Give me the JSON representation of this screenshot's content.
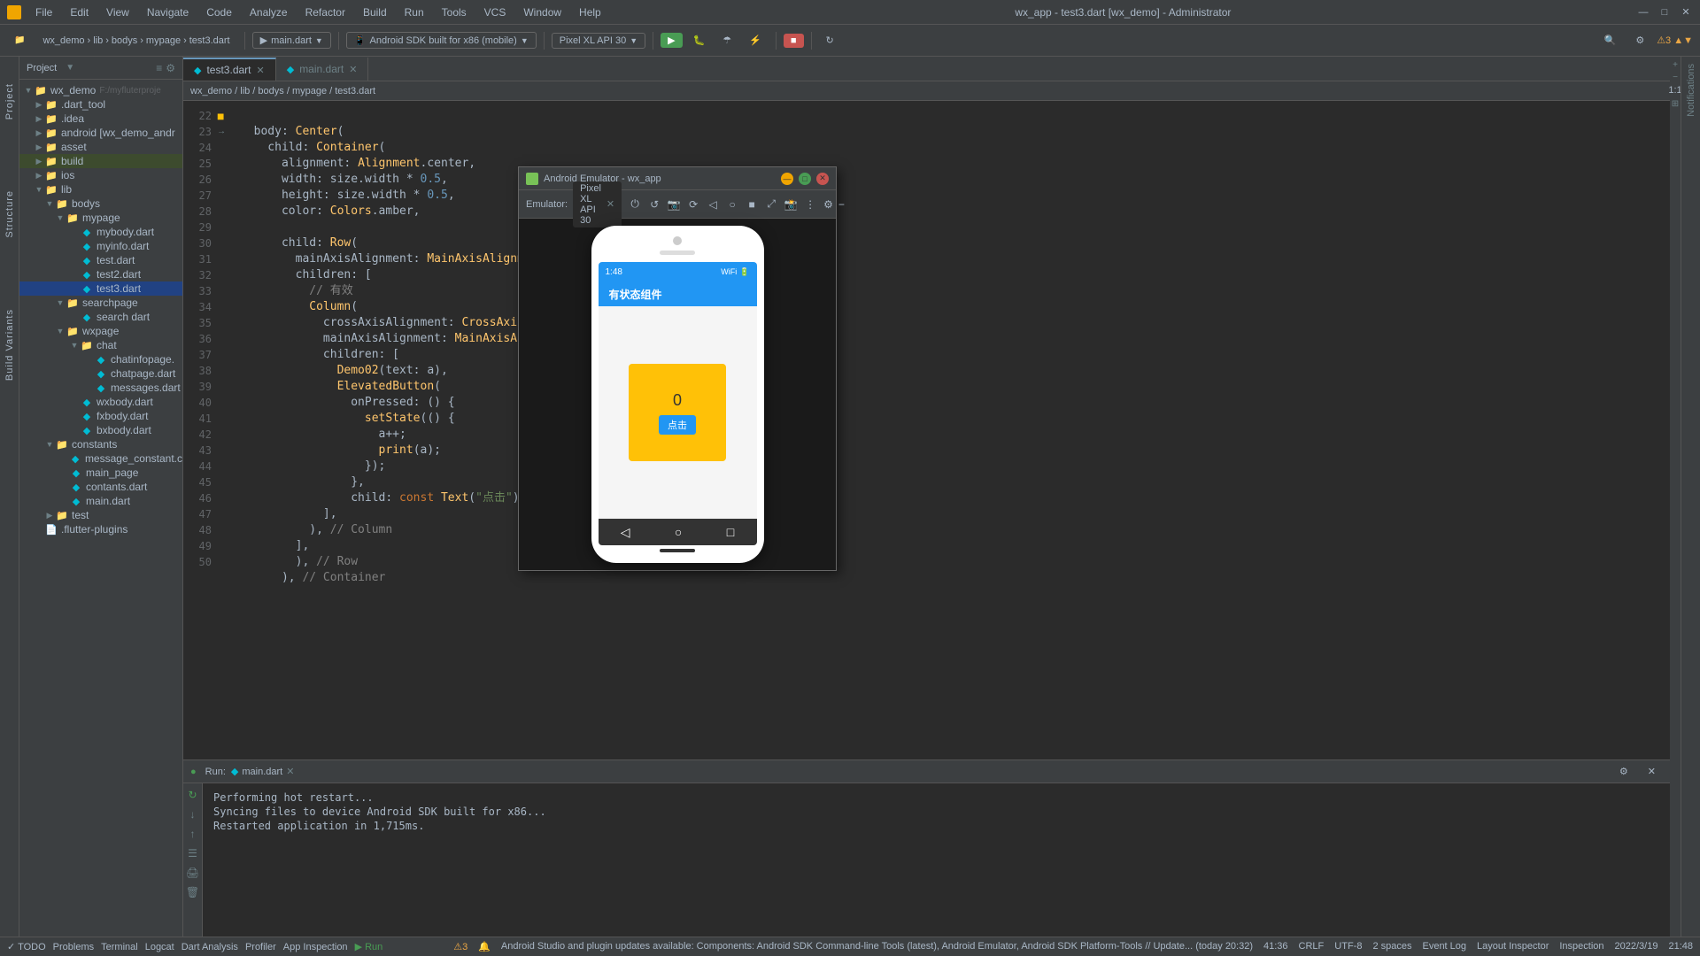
{
  "window": {
    "title": "wx_app - test3.dart [wx_demo] - Administrator",
    "min": "—",
    "max": "□",
    "close": "✕"
  },
  "menu": {
    "items": [
      "File",
      "Edit",
      "View",
      "Navigate",
      "Code",
      "Analyze",
      "Refactor",
      "Build",
      "Run",
      "Tools",
      "VCS",
      "Window",
      "Help"
    ]
  },
  "toolbar": {
    "project_label": "wx_demo",
    "lib_label": "lib",
    "bodys_label": "bodys",
    "mypage_label": "mypage",
    "file_label": "test3.dart",
    "run_config": "main.dart",
    "device": "Android SDK built for x86 (mobile)",
    "api": "Pixel XL API 30",
    "run_btn": "▶",
    "debug_btn": "🐛",
    "stop_btn": "■"
  },
  "breadcrumb": {
    "path": "wx_demo / lib / bodys / mypage / test3.dart"
  },
  "tabs": {
    "test3": "test3.dart",
    "main": "main.dart"
  },
  "project_panel": {
    "title": "Project",
    "root": "wx_demo",
    "root_path": "F:/myfluterproje",
    "items": [
      {
        "indent": 1,
        "label": ".dart_tool",
        "type": "folder",
        "open": true
      },
      {
        "indent": 1,
        "label": ".idea",
        "type": "folder"
      },
      {
        "indent": 1,
        "label": "android [wx_demo_andr",
        "type": "folder"
      },
      {
        "indent": 1,
        "label": "asset",
        "type": "folder"
      },
      {
        "indent": 1,
        "label": "build",
        "type": "folder",
        "highlight": true
      },
      {
        "indent": 1,
        "label": "ios",
        "type": "folder"
      },
      {
        "indent": 1,
        "label": "lib",
        "type": "folder",
        "open": true
      },
      {
        "indent": 2,
        "label": "bodys",
        "type": "folder",
        "open": true
      },
      {
        "indent": 3,
        "label": "mypage",
        "type": "folder",
        "open": true
      },
      {
        "indent": 4,
        "label": "mybody.dart",
        "type": "dart"
      },
      {
        "indent": 4,
        "label": "myinfo.dart",
        "type": "dart"
      },
      {
        "indent": 4,
        "label": "test.dart",
        "type": "dart"
      },
      {
        "indent": 4,
        "label": "test2.dart",
        "type": "dart"
      },
      {
        "indent": 4,
        "label": "test3.dart",
        "type": "dart",
        "selected": true
      },
      {
        "indent": 3,
        "label": "searchpage",
        "type": "folder",
        "open": true
      },
      {
        "indent": 4,
        "label": "search.dart",
        "type": "dart"
      },
      {
        "indent": 3,
        "label": "wxpage",
        "type": "folder",
        "open": true
      },
      {
        "indent": 4,
        "label": "chat",
        "type": "folder",
        "open": true
      },
      {
        "indent": 5,
        "label": "chatinfopage.",
        "type": "dart"
      },
      {
        "indent": 5,
        "label": "chatpage.dart",
        "type": "dart"
      },
      {
        "indent": 5,
        "label": "messages.dart",
        "type": "dart"
      },
      {
        "indent": 4,
        "label": "wxbody.dart",
        "type": "dart"
      },
      {
        "indent": 4,
        "label": "fxbody.dart",
        "type": "dart"
      },
      {
        "indent": 4,
        "label": "bxbody.dart",
        "type": "dart"
      },
      {
        "indent": 2,
        "label": "constants",
        "type": "folder",
        "open": true
      },
      {
        "indent": 3,
        "label": "message_constant.c",
        "type": "dart"
      },
      {
        "indent": 3,
        "label": "main_page",
        "type": "dart"
      },
      {
        "indent": 3,
        "label": "contants.dart",
        "type": "dart"
      },
      {
        "indent": 3,
        "label": "main.dart",
        "type": "dart"
      },
      {
        "indent": 2,
        "label": "test",
        "type": "folder"
      },
      {
        "indent": 1,
        "label": ".flutter-plugins",
        "type": "file"
      }
    ]
  },
  "code": {
    "lines": [
      {
        "num": 22,
        "content": "  body: Center("
      },
      {
        "num": 23,
        "content": "    child: Container("
      },
      {
        "num": 24,
        "content": "      alignment: Alignment.center,"
      },
      {
        "num": 25,
        "content": "      width: size.width * 0.5,"
      },
      {
        "num": 26,
        "content": "      height: size.width * 0.5,"
      },
      {
        "num": 27,
        "content": "      color: Colors.amber,",
        "has_indicator": true
      },
      {
        "num": 28,
        "content": ""
      },
      {
        "num": 29,
        "content": "      child: Row("
      },
      {
        "num": 30,
        "content": "        mainAxisAlignment: MainAxisAlignment.center,"
      },
      {
        "num": 31,
        "content": "        children: ["
      },
      {
        "num": 32,
        "content": "          // 有效"
      },
      {
        "num": 33,
        "content": "          Column("
      },
      {
        "num": 34,
        "content": "            crossAxisAlignment: CrossAxisAlignment.cen"
      },
      {
        "num": 35,
        "content": "            mainAxisAlignment: MainAxisAlignment.cente"
      },
      {
        "num": 36,
        "content": "            children: ["
      },
      {
        "num": 37,
        "content": "              Demo02(text: a),"
      },
      {
        "num": 38,
        "content": "              ElevatedButton("
      },
      {
        "num": 39,
        "content": "                onPressed: () {"
      },
      {
        "num": 40,
        "content": "                  setState(() {"
      },
      {
        "num": 41,
        "content": "                    a++;",
        "has_arrow": true
      },
      {
        "num": 42,
        "content": "                    print(a);"
      },
      {
        "num": 43,
        "content": "                  });"
      },
      {
        "num": 44,
        "content": "                },"
      },
      {
        "num": 45,
        "content": "                child: const Text(\"点击\")), // Eleva"
      },
      {
        "num": 46,
        "content": "            ],"
      },
      {
        "num": 47,
        "content": "          ), // Column"
      },
      {
        "num": 48,
        "content": "        ],"
      },
      {
        "num": 49,
        "content": "        ), // Row"
      },
      {
        "num": 50,
        "content": "      ), // Container"
      }
    ]
  },
  "run_panel": {
    "tab": "main.dart",
    "close": "✕",
    "lines": [
      "Performing hot restart...",
      "Syncing files to device Android SDK built for x86...",
      "Restarted application in 1,715ms."
    ]
  },
  "emulator": {
    "title": "Android Emulator - wx_app",
    "tab": "Pixel XL API 30",
    "phone": {
      "time": "1:48",
      "appbar_title": "有状态组件",
      "counter": "0",
      "button_label": "点击"
    }
  },
  "bottom_tabs": [
    {
      "label": "TODO"
    },
    {
      "label": "Problems"
    },
    {
      "label": "Terminal"
    },
    {
      "label": "Logcat"
    },
    {
      "label": "Dart Analysis"
    },
    {
      "label": "Profiler"
    },
    {
      "label": "App Inspection"
    },
    {
      "label": "Run",
      "active": true
    }
  ],
  "status_bar": {
    "warning_count": "⚠3",
    "position": "41:36",
    "encoding": "CRLF",
    "charset": "UTF-8",
    "spaces": "2 spaces",
    "date": "2022/3/19",
    "time": "21:48",
    "event_log": "Event Log",
    "layout_inspector": "Layout Inspector",
    "inspection": "Inspection"
  },
  "search_dart": {
    "label": "search dart"
  }
}
